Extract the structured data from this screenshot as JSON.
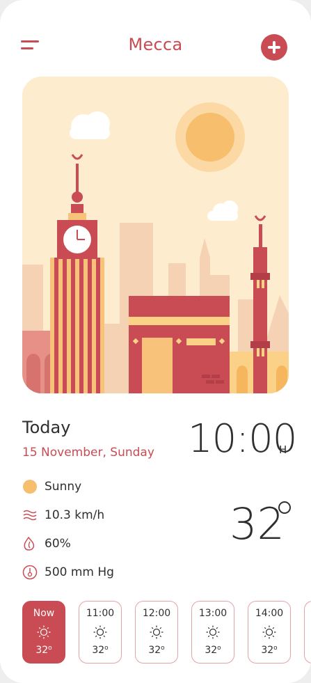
{
  "header": {
    "title": "Mecca",
    "menu_icon": "menu-icon",
    "add_icon": "plus-icon"
  },
  "colors": {
    "accent": "#c94b53",
    "sun": "#f6be6d",
    "sky": "#fdedce",
    "text": "#2f2f2f"
  },
  "today": {
    "label": "Today",
    "date": "15 November, Sunday",
    "time": "10:00",
    "time_suffix": "H"
  },
  "conditions": {
    "summary": "Sunny",
    "wind": "10.3 km/h",
    "humidity": "60%",
    "pressure": "500 mm Hg",
    "temperature": "32"
  },
  "hourly": [
    {
      "label": "Now",
      "temp": "32",
      "icon": "sun-icon",
      "active": true
    },
    {
      "label": "11:00",
      "temp": "32",
      "icon": "sun-icon"
    },
    {
      "label": "12:00",
      "temp": "32",
      "icon": "sun-icon"
    },
    {
      "label": "13:00",
      "temp": "32",
      "icon": "sun-icon"
    },
    {
      "label": "14:00",
      "temp": "32",
      "icon": "sun-icon"
    }
  ]
}
